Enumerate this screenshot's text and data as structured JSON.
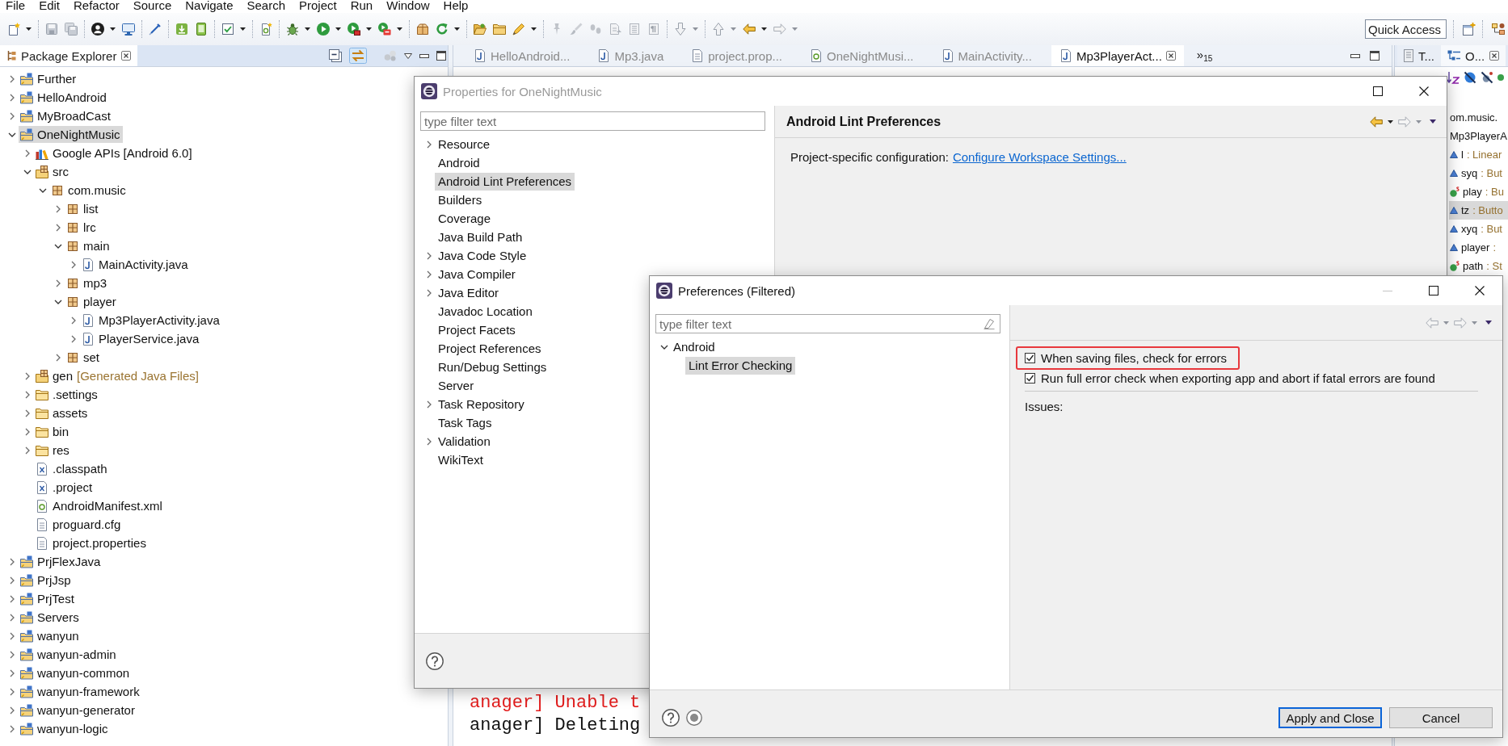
{
  "menu_bar": {
    "items": [
      "File",
      "Edit",
      "Refactor",
      "Source",
      "Navigate",
      "Search",
      "Project",
      "Run",
      "Window",
      "Help"
    ]
  },
  "quick_access": {
    "placeholder": "Quick Access"
  },
  "package_explorer": {
    "title": "Package Explorer",
    "items": [
      {
        "label": "Further",
        "kind": "project",
        "expanded": false,
        "selected": false
      },
      {
        "label": "HelloAndroid",
        "kind": "project",
        "expanded": false,
        "selected": false
      },
      {
        "label": "MyBroadCast",
        "kind": "project",
        "expanded": false,
        "selected": false
      },
      {
        "label": "OneNightMusic",
        "kind": "project",
        "expanded": true,
        "selected": true,
        "children": [
          {
            "label": "Google APIs [Android 6.0]",
            "kind": "library",
            "expanded": false,
            "selected": false
          },
          {
            "label": "src",
            "kind": "source-folder",
            "expanded": true,
            "selected": false,
            "children": [
              {
                "label": "com.music",
                "kind": "package",
                "expanded": true,
                "selected": false,
                "children": [
                  {
                    "label": "list",
                    "kind": "package",
                    "expanded": false,
                    "selected": false
                  },
                  {
                    "label": "lrc",
                    "kind": "package",
                    "expanded": false,
                    "selected": false
                  },
                  {
                    "label": "main",
                    "kind": "package",
                    "expanded": true,
                    "selected": false,
                    "children": [
                      {
                        "label": "MainActivity.java",
                        "kind": "java-file",
                        "expanded": false,
                        "selected": false
                      }
                    ]
                  },
                  {
                    "label": "mp3",
                    "kind": "package",
                    "expanded": false,
                    "selected": false
                  },
                  {
                    "label": "player",
                    "kind": "package",
                    "expanded": true,
                    "selected": false,
                    "children": [
                      {
                        "label": "Mp3PlayerActivity.java",
                        "kind": "java-file",
                        "expanded": false,
                        "selected": false
                      },
                      {
                        "label": "PlayerService.java",
                        "kind": "java-file",
                        "expanded": false,
                        "selected": false
                      }
                    ]
                  },
                  {
                    "label": "set",
                    "kind": "package",
                    "expanded": false,
                    "selected": false
                  }
                ]
              }
            ]
          },
          {
            "label": "gen",
            "note": "[Generated Java Files]",
            "kind": "source-folder",
            "expanded": false,
            "selected": false
          },
          {
            "label": ".settings",
            "kind": "folder",
            "expanded": false,
            "selected": false
          },
          {
            "label": "assets",
            "kind": "folder",
            "expanded": false,
            "selected": false
          },
          {
            "label": "bin",
            "kind": "folder",
            "expanded": false,
            "selected": false
          },
          {
            "label": "res",
            "kind": "folder",
            "expanded": false,
            "selected": false
          },
          {
            "label": ".classpath",
            "kind": "xml-file",
            "selected": false
          },
          {
            "label": ".project",
            "kind": "xml-file",
            "selected": false
          },
          {
            "label": "AndroidManifest.xml",
            "kind": "android-file",
            "selected": false
          },
          {
            "label": "proguard.cfg",
            "kind": "text-file",
            "selected": false
          },
          {
            "label": "project.properties",
            "kind": "text-file",
            "selected": false
          }
        ]
      },
      {
        "label": "PrjFlexJava",
        "kind": "project",
        "expanded": false,
        "selected": false
      },
      {
        "label": "PrjJsp",
        "kind": "project",
        "expanded": false,
        "selected": false
      },
      {
        "label": "PrjTest",
        "kind": "project",
        "expanded": false,
        "selected": false
      },
      {
        "label": "Servers",
        "kind": "project",
        "expanded": false,
        "selected": false
      },
      {
        "label": "wanyun",
        "kind": "project",
        "expanded": false,
        "selected": false
      },
      {
        "label": "wanyun-admin",
        "kind": "project",
        "expanded": false,
        "selected": false
      },
      {
        "label": "wanyun-common",
        "kind": "project",
        "expanded": false,
        "selected": false
      },
      {
        "label": "wanyun-framework",
        "kind": "project",
        "expanded": false,
        "selected": false
      },
      {
        "label": "wanyun-generator",
        "kind": "project",
        "expanded": false,
        "selected": false
      },
      {
        "label": "wanyun-logic",
        "kind": "project",
        "expanded": false,
        "selected": false
      }
    ]
  },
  "editor": {
    "tabs": [
      {
        "label": "HelloAndroid...",
        "kind": "java",
        "selected": false
      },
      {
        "label": "Mp3.java",
        "kind": "java",
        "selected": false
      },
      {
        "label": "project.prop...",
        "kind": "text",
        "selected": false
      },
      {
        "label": "OneNightMusi...",
        "kind": "android",
        "selected": false
      },
      {
        "label": "MainActivity...",
        "kind": "java",
        "selected": false
      },
      {
        "label": "Mp3PlayerAct...",
        "kind": "java",
        "selected": true
      }
    ],
    "overflow": {
      "symbol": "»",
      "count": "15"
    }
  },
  "console": {
    "lines": [
      {
        "text": "anager] Unable t",
        "kind": "error"
      },
      {
        "text": "anager] Deleting",
        "kind": "info"
      }
    ]
  },
  "outline": {
    "tabs": [
      {
        "label": "T...",
        "kind": "document",
        "selected": false
      },
      {
        "label": "O...",
        "kind": "outline",
        "selected": true
      }
    ],
    "items": [
      {
        "kind": "node",
        "name": "om.music.",
        "selected": false
      },
      {
        "kind": "node",
        "name": "Mp3PlayerA",
        "selected": false
      },
      {
        "kind": "field",
        "name": "l",
        "type": ": Linear",
        "selected": false
      },
      {
        "kind": "field",
        "name": "syq",
        "type": ": But",
        "selected": false
      },
      {
        "kind": "static-field",
        "name": "play",
        "type": ": Bu",
        "selected": false
      },
      {
        "kind": "field",
        "name": "tz",
        "type": ": Butto",
        "selected": true
      },
      {
        "kind": "field",
        "name": "xyq",
        "type": ": But",
        "selected": false
      },
      {
        "kind": "field",
        "name": "player",
        "type": ":",
        "selected": false
      },
      {
        "kind": "static-field",
        "name": "path",
        "type": ": St",
        "selected": false
      }
    ]
  },
  "properties_dialog": {
    "kind": "properties",
    "title": "Properties for OneNightMusic",
    "active": false,
    "back_enabled": true,
    "filter": {
      "placeholder": "type filter text",
      "clearable": false
    },
    "items": [
      {
        "label": "Resource",
        "expanded": false,
        "selected": false
      },
      {
        "label": "Android",
        "selected": false
      },
      {
        "label": "Android Lint Preferences",
        "selected": true
      },
      {
        "label": "Builders",
        "selected": false
      },
      {
        "label": "Coverage",
        "selected": false
      },
      {
        "label": "Java Build Path",
        "selected": false
      },
      {
        "label": "Java Code Style",
        "expanded": false,
        "selected": false
      },
      {
        "label": "Java Compiler",
        "expanded": false,
        "selected": false
      },
      {
        "label": "Java Editor",
        "expanded": false,
        "selected": false
      },
      {
        "label": "Javadoc Location",
        "selected": false
      },
      {
        "label": "Project Facets",
        "selected": false
      },
      {
        "label": "Project References",
        "selected": false
      },
      {
        "label": "Run/Debug Settings",
        "selected": false
      },
      {
        "label": "Server",
        "selected": false
      },
      {
        "label": "Task Repository",
        "expanded": false,
        "selected": false
      },
      {
        "label": "Task Tags",
        "selected": false
      },
      {
        "label": "Validation",
        "expanded": false,
        "selected": false
      },
      {
        "label": "WikiText",
        "selected": false
      }
    ],
    "page": {
      "title": "Android Lint Preferences",
      "text": "Project-specific configuration:",
      "link": "Configure Workspace Settings..."
    }
  },
  "preferences_dialog": {
    "kind": "preferences",
    "title": "Preferences (Filtered)",
    "active": true,
    "back_enabled": false,
    "filter": {
      "placeholder": "type filter text",
      "clearable": true
    },
    "items": [
      {
        "label": "Android",
        "expanded": true,
        "selected": false,
        "children": [
          {
            "label": "Lint Error Checking",
            "selected": true
          }
        ]
      }
    ],
    "options": [
      {
        "label": "When saving files, check for errors",
        "checked": true,
        "highlighted": true
      },
      {
        "label": "Run full error check when exporting app and abort if fatal errors are found",
        "checked": true,
        "highlighted": false
      }
    ],
    "issues_label": "Issues:",
    "buttons": [
      {
        "label": "Apply and Close",
        "default": true
      },
      {
        "label": "Cancel",
        "default": false
      }
    ]
  }
}
